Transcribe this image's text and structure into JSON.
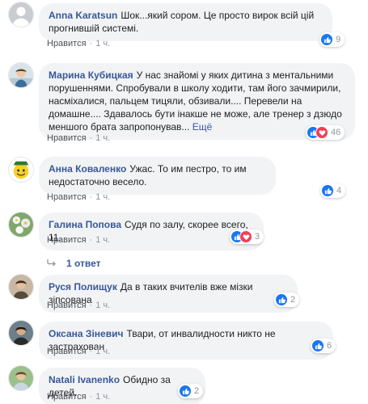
{
  "comments": [
    {
      "author": "Anna Karatsun",
      "text": "Шок...який сором. Це просто вирок всій цій прогнившій системі.",
      "like_label": "Нравится",
      "time": "1 ч.",
      "reaction_count": "9",
      "avatar_icon": "gray-silhouette"
    },
    {
      "author": "Марина Кубицкая",
      "text": "У нас знайомі у яких дитина з ментальними порушеннями. Спробували в школу ходити, там його зачмирили, насміхалися, пальцем тицяли, обзивали.... Перевели на домашне.... Здавалось бути інакше не може, але тренер з дзюдо меншого брата запропонував...",
      "more": "Ещё",
      "like_label": "Нравится",
      "time": "1 ч.",
      "reaction_count": "46",
      "avatar_icon": "child-photo"
    },
    {
      "author": "Анна Коваленко",
      "text": "Ужас. То им пестро, то им недостаточно весело.",
      "like_label": "Нравится",
      "time": "1 ч.",
      "reaction_count": "4",
      "avatar_icon": "emoji-with-hat"
    },
    {
      "author": "Галина Попова",
      "text": "Судя по залу, скорее всего, 11.",
      "like_label": "Нравится",
      "time": "1 ч.",
      "reaction_count": "3",
      "avatar_icon": "flowers-photo"
    },
    {
      "author": "Руся Полищук",
      "text": "Да в таких вчителів вже мізки зіпсована",
      "like_label": "Нравится",
      "time": "1 ч.",
      "reaction_count": "2",
      "avatar_icon": "person-photo"
    },
    {
      "author": "Оксана Зіневич",
      "text": "Твари, от инвалидности никто не застрахован",
      "like_label": "Нравится",
      "time": "1 ч.",
      "reaction_count": "6",
      "avatar_icon": "person-dark-photo"
    },
    {
      "author": "Natali Ivanenko",
      "text": "Обидно за детей.",
      "like_label": "Нравится",
      "time": "1 ч.",
      "reaction_count": "2",
      "avatar_icon": "person-outdoor-photo"
    }
  ],
  "replies": {
    "label": "1 ответ"
  },
  "colors": {
    "author": "#385898",
    "bubble": "#f2f3f5",
    "meta": "#90949c",
    "like": "#1877f2",
    "love": "#f33e58"
  }
}
